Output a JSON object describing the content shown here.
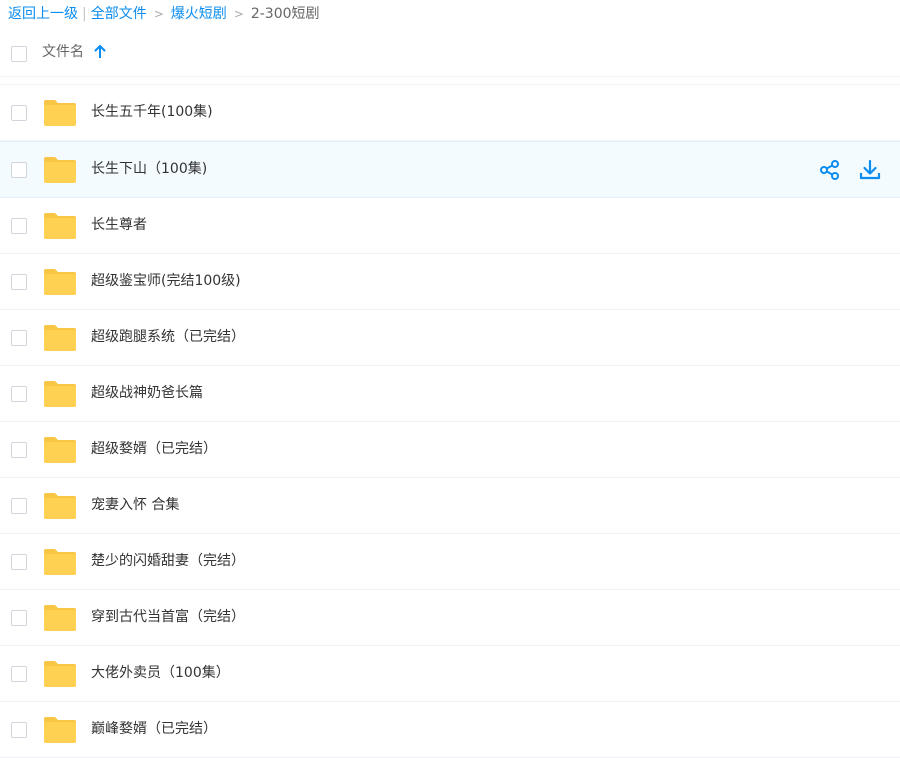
{
  "breadcrumb": {
    "back": "返回上一级",
    "separator": "|",
    "items": [
      "全部文件",
      "爆火短剧"
    ],
    "arrow": ">",
    "current": "2-300短剧"
  },
  "header": {
    "column_name": "文件名",
    "sort_icon": "arrow-up-icon",
    "sort_direction": "ascending"
  },
  "colors": {
    "link": "#0a8cf0",
    "folder": "#ffd152",
    "folder_tab": "#f9c545",
    "row_hover_bg": "#f4fbff",
    "action_icon": "#0a8cf0"
  },
  "row_actions": {
    "share_icon": "share-icon",
    "download_icon": "download-icon"
  },
  "files": [
    {
      "name": "长生五千年(100集)",
      "type": "folder"
    },
    {
      "name": "长生下山（100集)",
      "type": "folder",
      "hovered": true
    },
    {
      "name": "长生尊者",
      "type": "folder"
    },
    {
      "name": "超级鉴宝师(完结100级)",
      "type": "folder"
    },
    {
      "name": "超级跑腿系统（已完结）",
      "type": "folder"
    },
    {
      "name": "超级战神奶爸长篇",
      "type": "folder"
    },
    {
      "name": "超级婺婿（已完结）",
      "type": "folder"
    },
    {
      "name": "宠妻入怀 合集",
      "type": "folder"
    },
    {
      "name": "楚少的闪婚甜妻（完结）",
      "type": "folder"
    },
    {
      "name": "穿到古代当首富（完结）",
      "type": "folder"
    },
    {
      "name": "大佬外卖员（100集）",
      "type": "folder"
    },
    {
      "name": "巅峰婺婿（已完结）",
      "type": "folder"
    }
  ]
}
